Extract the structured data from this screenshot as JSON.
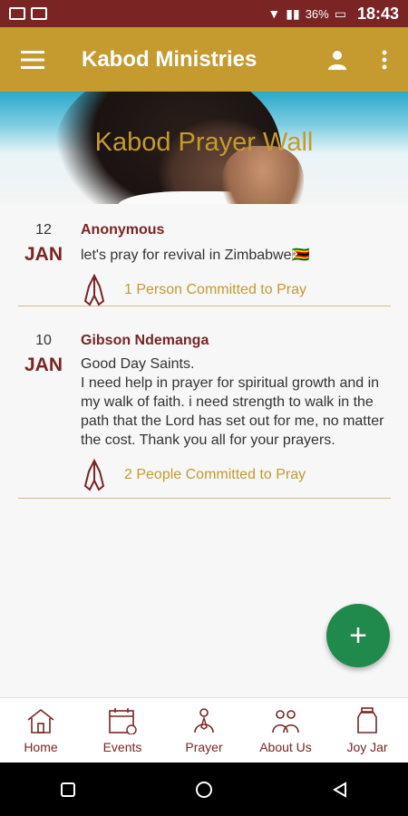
{
  "status_bar": {
    "battery": "36%",
    "time": "18:43"
  },
  "app_bar": {
    "title": "Kabod Ministries"
  },
  "banner": {
    "heading": "Kabod Prayer Wall"
  },
  "posts": [
    {
      "day": "12",
      "month": "JAN",
      "author": "Anonymous",
      "message": "let's pray for revival in  Zimbabwe🇿🇼",
      "commit_text": "1 Person Committed to Pray"
    },
    {
      "day": "10",
      "month": "JAN",
      "author": "Gibson Ndemanga",
      "message": "Good Day Saints.\nI need help in prayer for spiritual growth and in my walk of faith. i need strength to walk in the path that the Lord has set out for me, no matter the cost. Thank you all for your prayers.",
      "commit_text": "2 People Committed to Pray"
    }
  ],
  "fab": {
    "label": "+"
  },
  "bottom_nav": [
    {
      "label": "Home",
      "icon": "home-icon"
    },
    {
      "label": "Events",
      "icon": "calendar-icon"
    },
    {
      "label": "Prayer",
      "icon": "praying-person-icon"
    },
    {
      "label": "About Us",
      "icon": "people-icon"
    },
    {
      "label": "Joy Jar",
      "icon": "jar-icon"
    }
  ],
  "colors": {
    "primary_maroon": "#7a2424",
    "accent_gold": "#c59a2f",
    "fab_green": "#1f8a4c"
  }
}
